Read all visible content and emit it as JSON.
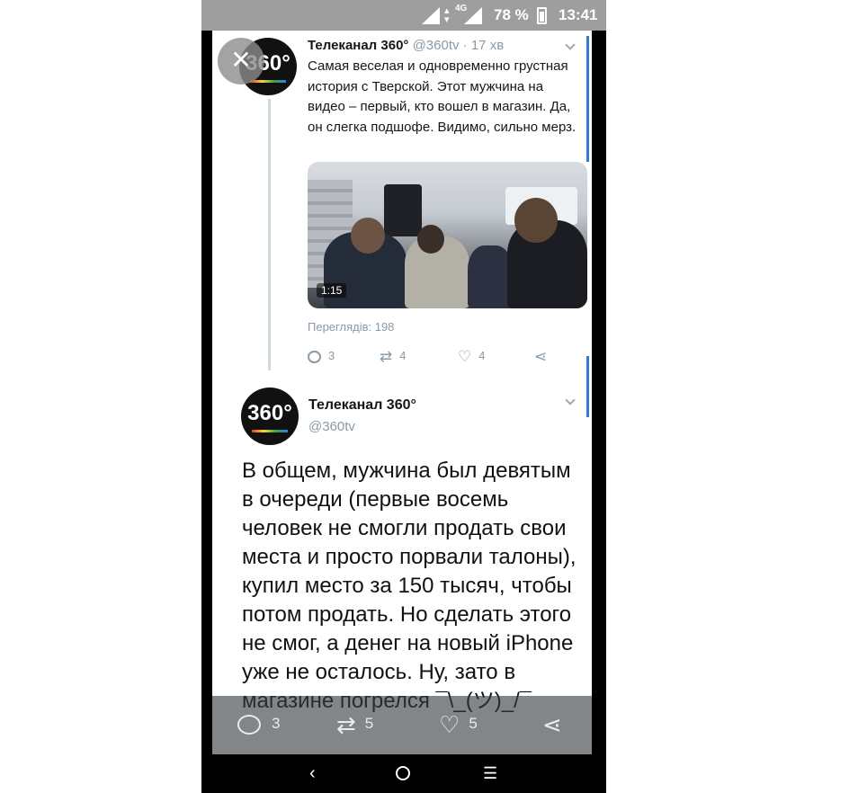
{
  "status_bar": {
    "network": "4G",
    "battery": "78 %",
    "time": "13:41"
  },
  "close_icon": "close-icon",
  "tweet1": {
    "avatar_text": "360°",
    "name": "Телеканал 360°",
    "handle": "@360tv",
    "time": "17 хв",
    "text": "Самая веселая и одновременно грустная история с Тверской. Этот мужчина на видео – первый, кто вошел в магазин. Да, он слегка подшофе. Видимо, сильно мерз.",
    "video_duration": "1:15",
    "views": "Переглядів: 198",
    "replies": "3",
    "retweets": "4",
    "likes": "4"
  },
  "tweet2": {
    "avatar_text": "360°",
    "name": "Телеканал 360°",
    "handle": "@360tv",
    "text": "В общем, мужчина был девятым в очереди (первые восемь человек не смогли продать свои места и просто порвали талоны), купил место за 150 тысяч, чтобы потом продать. Но сделать этого не смог, а денег на новый iPhone уже не осталось. Ну, зато в магазине погрелся ¯\\_(ツ)_/¯",
    "replies": "3",
    "retweets": "5",
    "likes": "5"
  },
  "nav": {
    "back": "‹",
    "menu": "☰"
  },
  "colors": {
    "accent": "#2f7cc9",
    "muted": "#8a9aa7"
  }
}
